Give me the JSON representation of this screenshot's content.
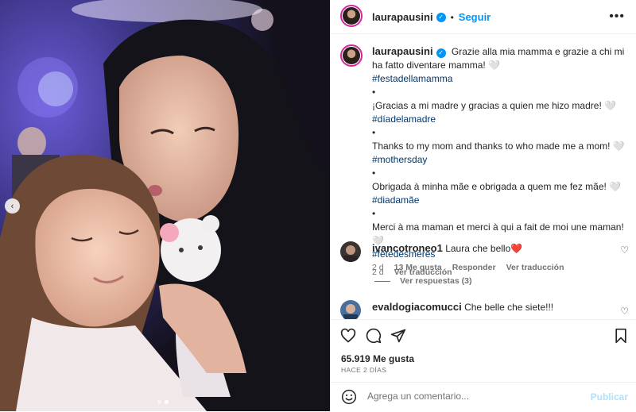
{
  "post": {
    "username": "laurapausini",
    "follow_label": "Seguir",
    "more_label": "•••",
    "caption": {
      "lines": [
        {
          "text": "Grazie alla mia mamma e grazie a chi mi ha fatto diventare mamma! 🤍",
          "kind": "text"
        },
        {
          "text": "#festadellamamma",
          "kind": "tag"
        },
        {
          "text": "•",
          "kind": "text"
        },
        {
          "text": "¡Gracias a mi madre y gracias a quien me hizo madre! 🤍",
          "kind": "text"
        },
        {
          "text": "#díadelamadre",
          "kind": "tag"
        },
        {
          "text": "•",
          "kind": "text"
        },
        {
          "text": "Thanks to my mom and thanks to who made me a mom! 🤍",
          "kind": "text"
        },
        {
          "text": "#mothersday",
          "kind": "tag"
        },
        {
          "text": "•",
          "kind": "text"
        },
        {
          "text": "Obrigada à minha mãe e obrigada a quem me fez mãe! 🤍",
          "kind": "text"
        },
        {
          "text": "#diadamãe",
          "kind": "tag"
        },
        {
          "text": "•",
          "kind": "text"
        },
        {
          "text": "Merci à ma maman et merci à qui a fait de moi une maman! 🤍",
          "kind": "text"
        },
        {
          "text": "#fêtedesmères",
          "kind": "tag"
        }
      ],
      "time": "2 d",
      "translate": "Ver traducción"
    },
    "comments": [
      {
        "username": "ivancotroneo1",
        "text": "Laura che bello❤️",
        "time": "2 d",
        "likes": "13 Me gusta",
        "reply": "Responder",
        "translate": "Ver traducción"
      },
      {
        "username": "evaldogiacomucci",
        "text": "Che belle che siete!!!"
      }
    ],
    "view_replies": "Ver respuestas (3)",
    "likes": "65.919 Me gusta",
    "date": "HACE 2 DÍAS",
    "comment_placeholder": "Agrega un comentario...",
    "publish_label": "Publicar",
    "carousel": {
      "total": 2,
      "active": 2
    },
    "colors": {
      "accent": "#0095f6",
      "tag": "#00376b",
      "publish_disabled": "#b2dffc",
      "ring": "#d6249f"
    }
  }
}
